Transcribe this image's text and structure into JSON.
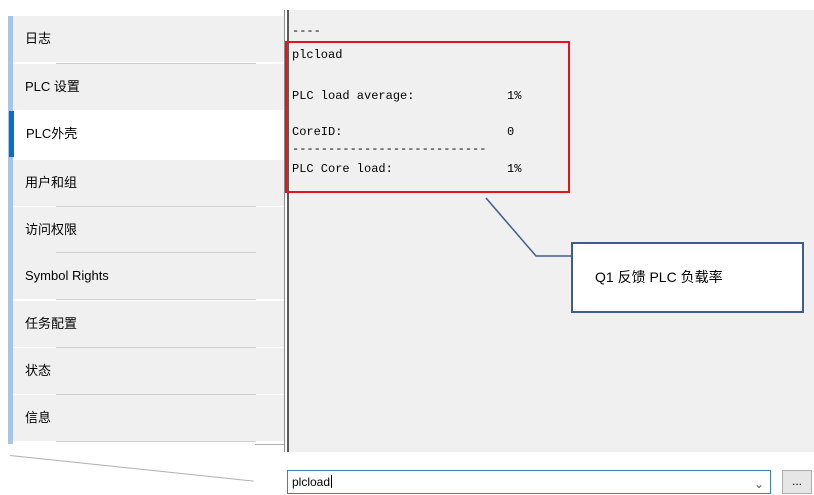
{
  "sidebar": {
    "items": [
      {
        "label": "日志"
      },
      {
        "label": "PLC 设置"
      },
      {
        "label": "PLC外壳",
        "active": true
      },
      {
        "label": "用户和组"
      },
      {
        "label": "访问权限"
      },
      {
        "label": "Symbol Rights"
      },
      {
        "label": "任务配置"
      },
      {
        "label": "状态"
      },
      {
        "label": "信息"
      }
    ]
  },
  "console": {
    "separator_short": "----",
    "command_echo": "plcload",
    "load_average_label": "PLC load average:",
    "load_average_value": "1%",
    "core_id_label": "CoreID:",
    "core_id_value": "0",
    "separator_long": "---------------------------",
    "core_load_label": "PLC Core load:",
    "core_load_value": "1%"
  },
  "annotation": {
    "callout_text": "Q1 反馈 PLC 负载率",
    "box_color": "#e5141b",
    "callout_border_color": "#3f5d8c"
  },
  "command_bar": {
    "input_value": "plcload",
    "more_button_label": "...",
    "dropdown_icon": "chevron-down-icon"
  },
  "colors": {
    "accent": "#0a6cc4",
    "sidebar_strip": "#a8c4e8"
  }
}
